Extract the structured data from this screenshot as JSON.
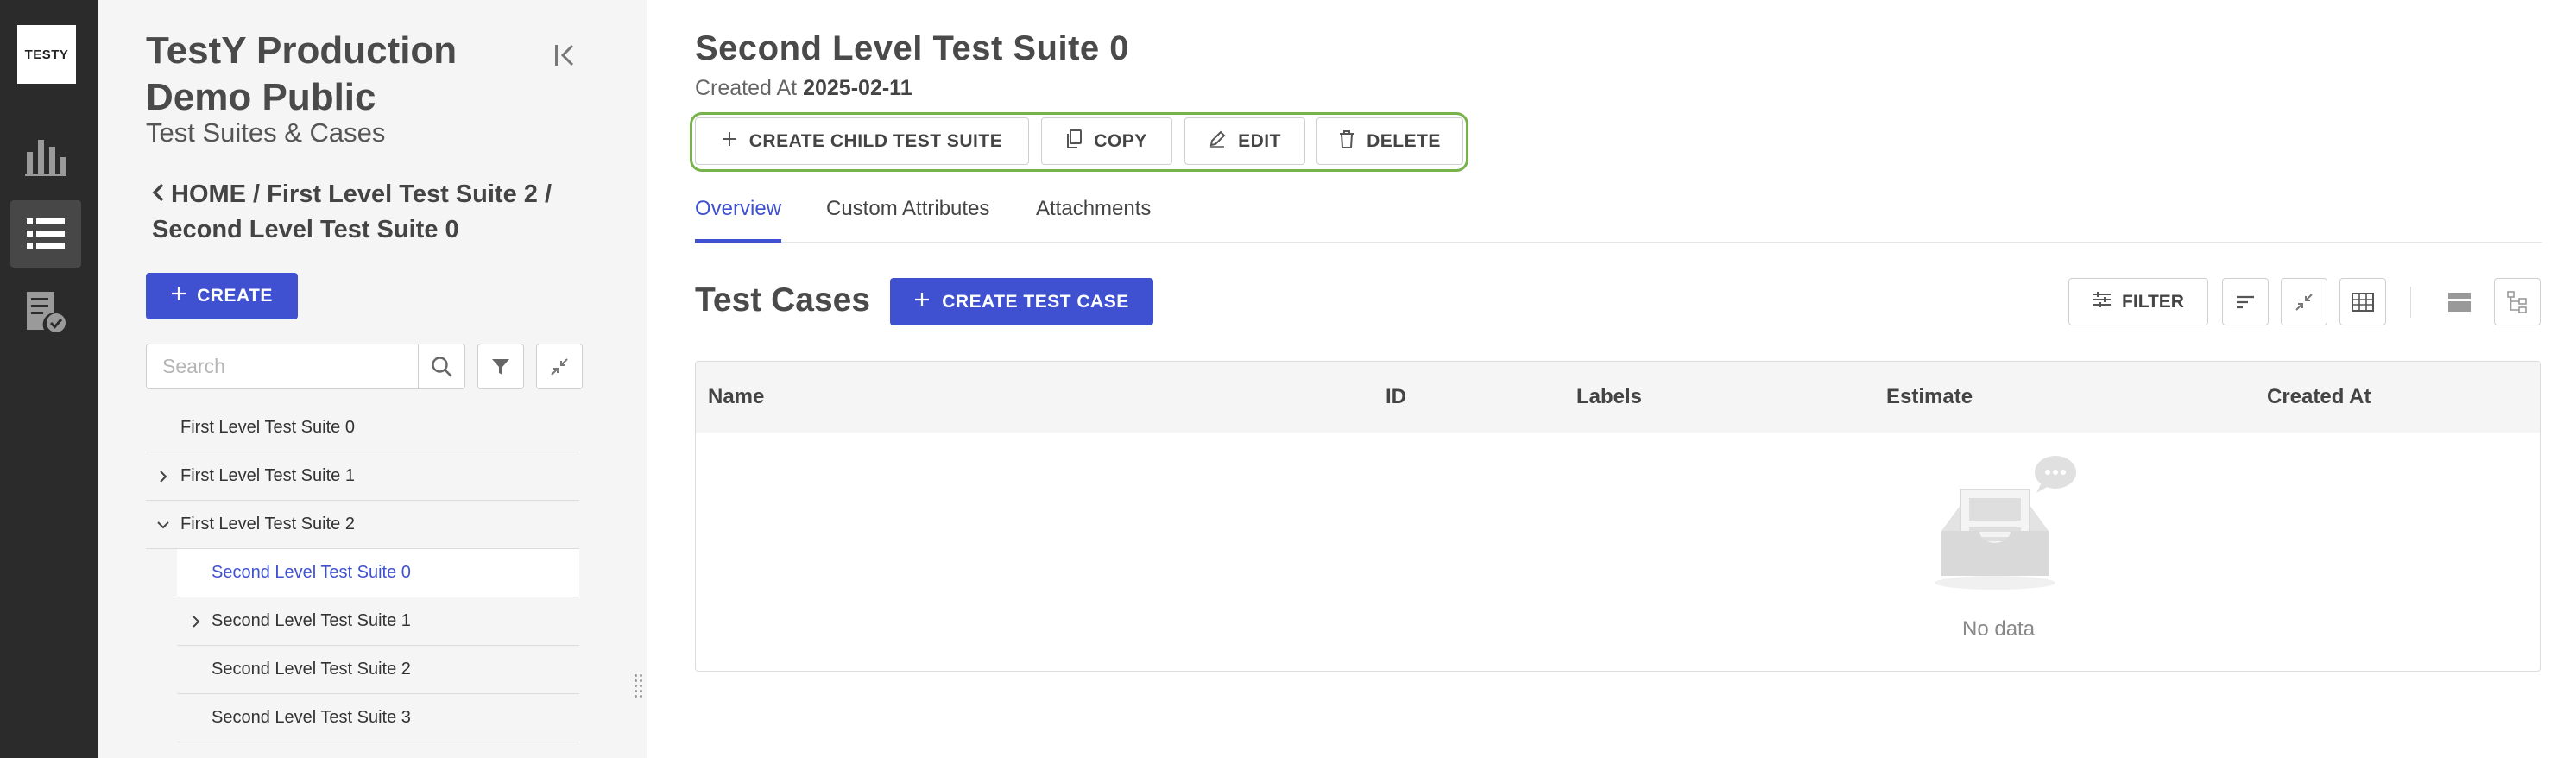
{
  "rail": {
    "logo": "TESTY"
  },
  "sidebar": {
    "project_title": "TestY Production Demo Public",
    "section_subtitle": "Test Suites & Cases",
    "breadcrumb": "HOME / First Level Test Suite 2 / Second Level Test Suite 0",
    "create_label": "CREATE",
    "search_placeholder": "Search",
    "tree": [
      {
        "label": "First Level Test Suite 0"
      },
      {
        "label": "First Level Test Suite 1"
      },
      {
        "label": "First Level Test Suite 2"
      },
      {
        "label": "Second Level Test Suite 0"
      },
      {
        "label": "Second Level Test Suite 1"
      },
      {
        "label": "Second Level Test Suite 2"
      },
      {
        "label": "Second Level Test Suite 3"
      }
    ]
  },
  "main": {
    "suite_title": "Second Level Test Suite 0",
    "created_label": "Created At",
    "created_date": "2025-02-11",
    "actions": {
      "create_child": "CREATE CHILD TEST SUITE",
      "copy": "COPY",
      "edit": "EDIT",
      "delete": "DELETE"
    },
    "tabs": [
      "Overview",
      "Custom Attributes",
      "Attachments"
    ],
    "test_cases_title": "Test Cases",
    "create_test_case": "CREATE TEST CASE",
    "filter_label": "FILTER",
    "table": {
      "columns": [
        "Name",
        "ID",
        "Labels",
        "Estimate",
        "Created At"
      ],
      "empty_text": "No data"
    }
  },
  "colors": {
    "primary": "#3f51d1",
    "rail_bg": "#2b2b2b",
    "highlight_outline": "#77b24a"
  }
}
